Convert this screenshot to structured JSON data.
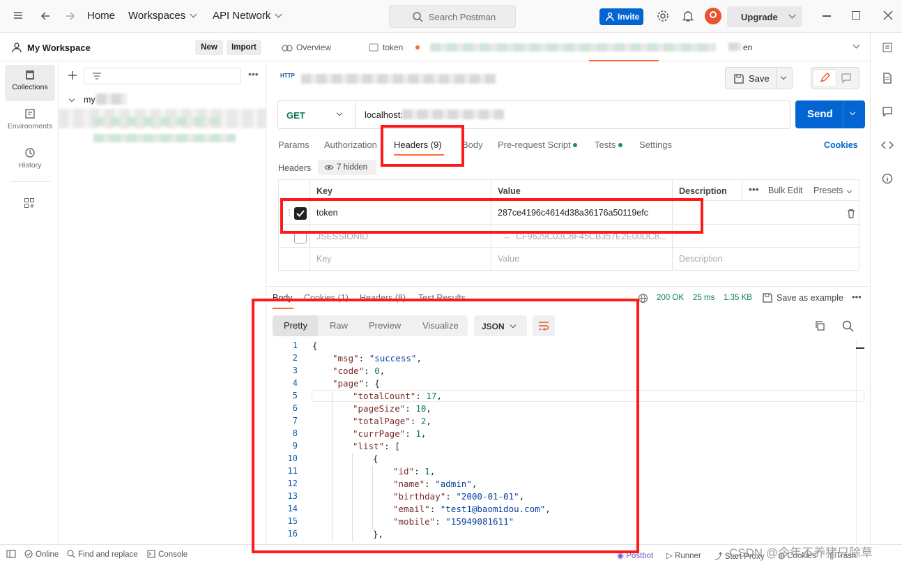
{
  "topbar": {
    "home": "Home",
    "workspaces": "Workspaces",
    "api_network": "API Network",
    "search_placeholder": "Search Postman",
    "invite": "Invite",
    "upgrade": "Upgrade"
  },
  "sidebar": {
    "workspace_name": "My Workspace",
    "new_label": "New",
    "import_label": "Import",
    "rail": [
      {
        "label": "Collections",
        "icon": "collections-icon"
      },
      {
        "label": "Environments",
        "icon": "environments-icon"
      },
      {
        "label": "History",
        "icon": "history-icon"
      }
    ],
    "tree_root": "my"
  },
  "tabs": {
    "overview": "Overview",
    "token_tab": "token",
    "last_tab_suffix": "en"
  },
  "request": {
    "save_label": "Save",
    "method": "GET",
    "url": "localhost:",
    "send_label": "Send",
    "tabs": [
      "Params",
      "Authorization",
      "Headers (9)",
      "Body",
      "Pre-request Script",
      "Tests",
      "Settings"
    ],
    "cookies_link": "Cookies",
    "headers_title": "Headers",
    "hidden_badge": "7 hidden",
    "table": {
      "col_key": "Key",
      "col_value": "Value",
      "col_desc": "Description",
      "bulk_edit": "Bulk Edit",
      "presets": "Presets",
      "rows": [
        {
          "key": "token",
          "value": "287ce4196c4614d38a36176a50119efc",
          "checked": true
        },
        {
          "key": "JSESSIONID",
          "value": "CF9629C03C8F45CB357E2E00DC8...",
          "checked": false
        }
      ],
      "placeholder_key": "Key",
      "placeholder_value": "Value",
      "placeholder_desc": "Description"
    }
  },
  "response": {
    "tabs": [
      "Body",
      "Cookies (1)",
      "Headers (8)",
      "Test Results"
    ],
    "status": "200 OK",
    "time": "25 ms",
    "size": "1.35 KB",
    "save_example": "Save as example",
    "views": [
      "Pretty",
      "Raw",
      "Preview",
      "Visualize"
    ],
    "format": "JSON",
    "lines": [
      {
        "n": "1",
        "indent": 0,
        "parts": [
          [
            "p",
            "{"
          ]
        ]
      },
      {
        "n": "2",
        "indent": 1,
        "parts": [
          [
            "k",
            "\"msg\""
          ],
          [
            "p",
            ": "
          ],
          [
            "s",
            "\"success\""
          ],
          [
            "p",
            ","
          ]
        ]
      },
      {
        "n": "3",
        "indent": 1,
        "parts": [
          [
            "k",
            "\"code\""
          ],
          [
            "p",
            ": "
          ],
          [
            "n",
            "0"
          ],
          [
            "p",
            ","
          ]
        ]
      },
      {
        "n": "4",
        "indent": 1,
        "parts": [
          [
            "k",
            "\"page\""
          ],
          [
            "p",
            ": {"
          ]
        ]
      },
      {
        "n": "5",
        "indent": 2,
        "parts": [
          [
            "k",
            "\"totalCount\""
          ],
          [
            "p",
            ": "
          ],
          [
            "n",
            "17"
          ],
          [
            "p",
            ","
          ]
        ]
      },
      {
        "n": "6",
        "indent": 2,
        "parts": [
          [
            "k",
            "\"pageSize\""
          ],
          [
            "p",
            ": "
          ],
          [
            "n",
            "10"
          ],
          [
            "p",
            ","
          ]
        ]
      },
      {
        "n": "7",
        "indent": 2,
        "parts": [
          [
            "k",
            "\"totalPage\""
          ],
          [
            "p",
            ": "
          ],
          [
            "n",
            "2"
          ],
          [
            "p",
            ","
          ]
        ]
      },
      {
        "n": "8",
        "indent": 2,
        "parts": [
          [
            "k",
            "\"currPage\""
          ],
          [
            "p",
            ": "
          ],
          [
            "n",
            "1"
          ],
          [
            "p",
            ","
          ]
        ]
      },
      {
        "n": "9",
        "indent": 2,
        "parts": [
          [
            "k",
            "\"list\""
          ],
          [
            "p",
            ": ["
          ]
        ]
      },
      {
        "n": "10",
        "indent": 3,
        "parts": [
          [
            "p",
            "{"
          ]
        ]
      },
      {
        "n": "11",
        "indent": 4,
        "parts": [
          [
            "k",
            "\"id\""
          ],
          [
            "p",
            ": "
          ],
          [
            "n",
            "1"
          ],
          [
            "p",
            ","
          ]
        ]
      },
      {
        "n": "12",
        "indent": 4,
        "parts": [
          [
            "k",
            "\"name\""
          ],
          [
            "p",
            ": "
          ],
          [
            "s",
            "\"admin\""
          ],
          [
            "p",
            ","
          ]
        ]
      },
      {
        "n": "13",
        "indent": 4,
        "parts": [
          [
            "k",
            "\"birthday\""
          ],
          [
            "p",
            ": "
          ],
          [
            "s",
            "\"2000-01-01\""
          ],
          [
            "p",
            ","
          ]
        ]
      },
      {
        "n": "14",
        "indent": 4,
        "parts": [
          [
            "k",
            "\"email\""
          ],
          [
            "p",
            ": "
          ],
          [
            "s",
            "\"test1@baomidou.com\""
          ],
          [
            "p",
            ","
          ]
        ]
      },
      {
        "n": "15",
        "indent": 4,
        "parts": [
          [
            "k",
            "\"mobile\""
          ],
          [
            "p",
            ": "
          ],
          [
            "s",
            "\"15949081611\""
          ]
        ]
      },
      {
        "n": "16",
        "indent": 3,
        "parts": [
          [
            "p",
            "},"
          ]
        ]
      }
    ]
  },
  "statusbar": {
    "online": "Online",
    "find_replace": "Find and replace",
    "console": "Console",
    "postbot": "Postbot",
    "runner": "Runner",
    "start_proxy": "Start Proxy",
    "cookies": "Cookies",
    "trash": "Trash",
    "watermark": "CSDN @今年不养猪只除草"
  },
  "colors": {
    "accent": "#0265d2",
    "annotation": "#ff1a1a",
    "status_ok": "#0a7a52",
    "active_tab": "#ff6c37"
  }
}
